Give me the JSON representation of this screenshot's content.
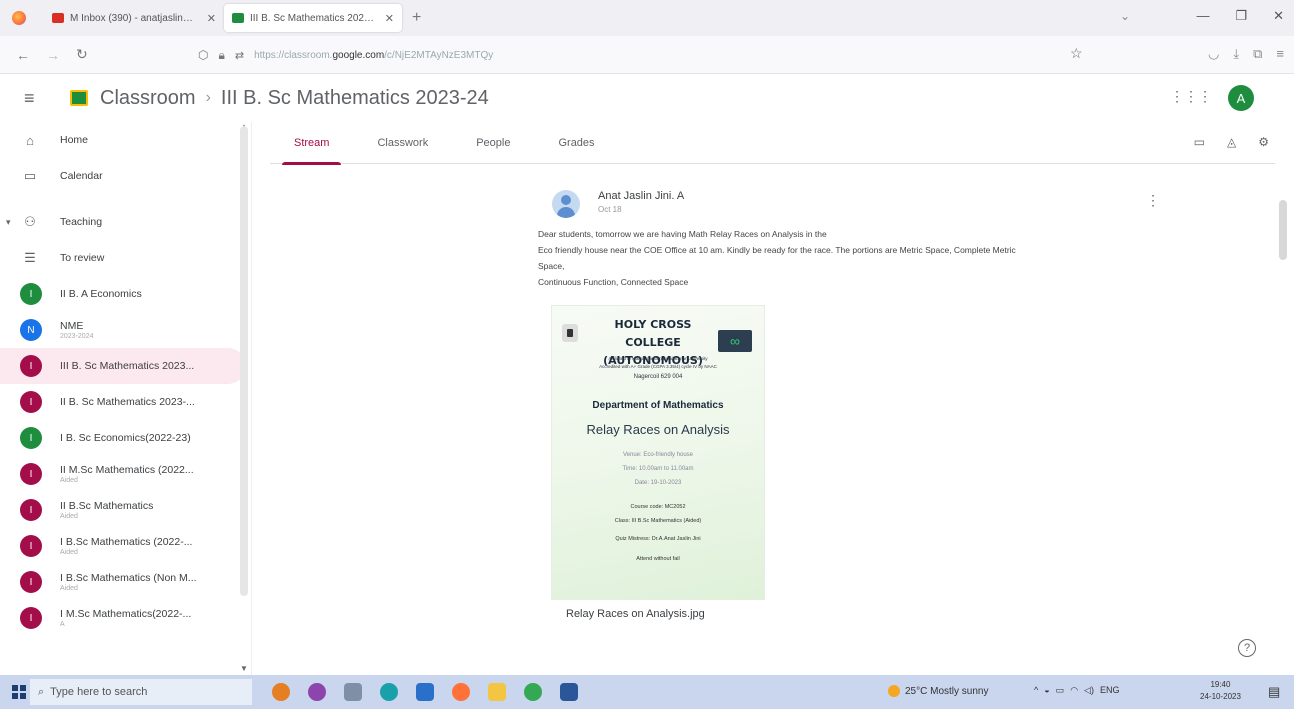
{
  "browser": {
    "tabs": [
      {
        "title": "M Inbox (390) - anatjaslin@holy",
        "fav_color": "#d93025"
      },
      {
        "title": "III B. Sc Mathematics 2023-24",
        "fav_color": "#1e8e3e"
      }
    ],
    "new_tab": "+",
    "url_prefix": "https://classroom.",
    "url_domain": "google.com",
    "url_suffix": "/c/NjE2MTAyNzE3MTQy"
  },
  "header": {
    "app_name": "Classroom",
    "breadcrumb_sep": "›",
    "class_title": "III B. Sc Mathematics 2023-24",
    "account_initial": "A"
  },
  "sidebar": {
    "top_items": [
      {
        "label": "Home",
        "icon": "home-icon"
      },
      {
        "label": "Calendar",
        "icon": "calendar-icon"
      }
    ],
    "teaching": {
      "label": "Teaching",
      "icon": "teaching-icon"
    },
    "to_review": {
      "label": "To review",
      "icon": "to-review-icon"
    },
    "classes": [
      {
        "initial": "I",
        "name": "II B. A Economics",
        "sub": "",
        "color": "#1e8e3e"
      },
      {
        "initial": "N",
        "name": "NME",
        "sub": "2023-2024",
        "color": "#1a73e8"
      },
      {
        "initial": "I",
        "name": "III B. Sc Mathematics 2023...",
        "sub": "",
        "color": "#a30e4a"
      },
      {
        "initial": "I",
        "name": "II B. Sc Mathematics 2023-...",
        "sub": "",
        "color": "#a30e4a"
      },
      {
        "initial": "I",
        "name": "I B. Sc Economics(2022-23)",
        "sub": "",
        "color": "#1e8e3e"
      },
      {
        "initial": "I",
        "name": "II M.Sc Mathematics (2022...",
        "sub": "Aided",
        "color": "#a30e4a"
      },
      {
        "initial": "I",
        "name": "II B.Sc Mathematics",
        "sub": "Aided",
        "color": "#a30e4a"
      },
      {
        "initial": "I",
        "name": "I B.Sc Mathematics (2022-...",
        "sub": "Aided",
        "color": "#a30e4a"
      },
      {
        "initial": "I",
        "name": "I B.Sc Mathematics (Non M...",
        "sub": "Aided",
        "color": "#a30e4a"
      },
      {
        "initial": "I",
        "name": "I M.Sc Mathematics(2022-...",
        "sub": "A",
        "color": "#a30e4a"
      }
    ]
  },
  "tabs": [
    {
      "label": "Stream",
      "active": true
    },
    {
      "label": "Classwork",
      "active": false
    },
    {
      "label": "People",
      "active": false
    },
    {
      "label": "Grades",
      "active": false
    }
  ],
  "post": {
    "author": "Anat Jaslin Jini. A",
    "date": "Oct 18",
    "line1": "Dear students, tomorrow we are having Math Relay Races on Analysis in the",
    "line2": "Eco friendly house near the COE Office at 10 am. Kindly be ready for the race. The portions are Metric Space, Complete Metric",
    "line3": "Space,",
    "line4": "Continuous Function, Connected Space",
    "attachment": "Relay Races on Analysis.jpg"
  },
  "poster": {
    "college_line1": "HOLY CROSS COLLEGE",
    "college_line2": "(AUTONOMOUS)",
    "affiliation": "Affiliated to Manonmaniam Sundaranar University",
    "accreditation": "Accredited with A+ Grade (CGPA 3.35/4) cycle IV by NAAC",
    "city": "Nagercoil 629 004",
    "department": "Department of Mathematics",
    "event": "Relay Races on Analysis",
    "venue": "Venue: Eco-friendly house",
    "time": "Time: 10.00am to 11.00am",
    "date": "Date: 19-10-2023",
    "course_code": "Course code: MC2052",
    "class": "Class: III B.Sc Mathematics (Aided)",
    "quiz_mistress": "Quiz Mistress: Dr.A.Anat Jaslin Jini",
    "attend": "Attend without fail"
  },
  "taskbar": {
    "search_placeholder": "Type here to search",
    "weather": "25°C Mostly sunny",
    "lang": "ENG",
    "time": "19:40",
    "date": "24-10-2023"
  }
}
